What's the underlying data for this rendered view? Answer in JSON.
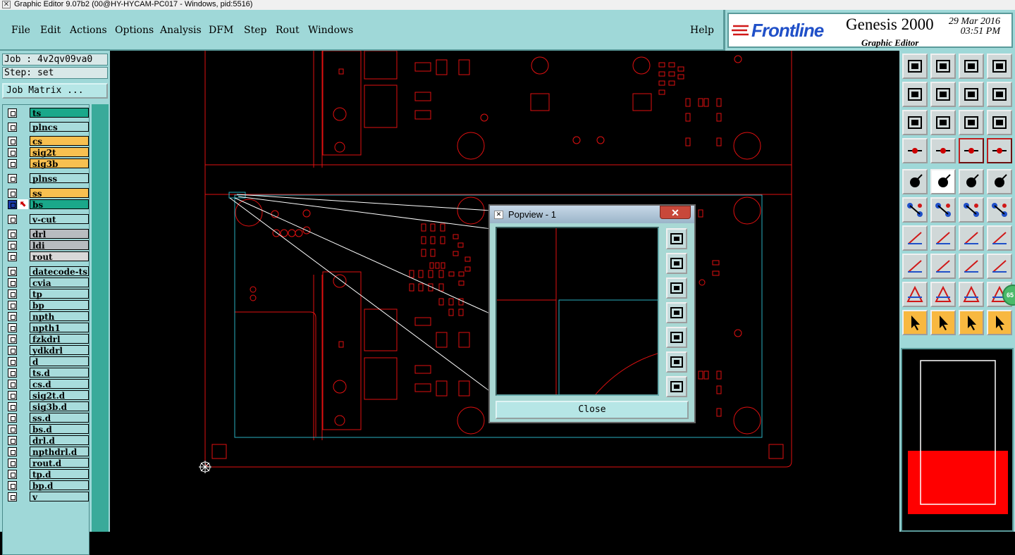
{
  "window": {
    "title": "Graphic Editor 9.07b2 (00@HY-HYCAM-PC017 - Windows, pid:5516)"
  },
  "menu": {
    "items": [
      {
        "label": "File"
      },
      {
        "label": "Edit"
      },
      {
        "label": "Actions"
      },
      {
        "label": "Options"
      },
      {
        "label": "Analysis"
      },
      {
        "label": "DFM"
      },
      {
        "label": "Step"
      },
      {
        "label": "Rout"
      },
      {
        "label": "Windows"
      }
    ],
    "help": "Help"
  },
  "brand": {
    "logo": "Frontline",
    "product": "Genesis 2000",
    "date": "29 Mar 2016",
    "time": "03:51 PM",
    "subtitle": "Graphic Editor"
  },
  "job": {
    "job_label": "Job : 4v2qv09va0",
    "step_label": "Step: set",
    "matrix_button": "Job Matrix ..."
  },
  "layers": [
    {
      "name": "ts",
      "color": "#1aa88a"
    },
    {
      "name": "plncs",
      "color": "#a8dcdc"
    },
    {
      "name": "cs",
      "color": "#f8c050"
    },
    {
      "name": "sig2t",
      "color": "#f8c050"
    },
    {
      "name": "sig3b",
      "color": "#f8c050"
    },
    {
      "name": "plnss",
      "color": "#a8dcdc"
    },
    {
      "name": "ss",
      "color": "#f8c050"
    },
    {
      "name": "bs",
      "color": "#1aa88a",
      "active": true
    },
    {
      "name": "v-cut",
      "color": "#a8dcdc"
    },
    {
      "name": "drl",
      "color": "#b8bcc0"
    },
    {
      "name": "ldi",
      "color": "#b8bcc0"
    },
    {
      "name": "rout",
      "color": "#d8d8d8"
    },
    {
      "name": "datecode-ts",
      "color": "#a8dcdc"
    },
    {
      "name": "cvia",
      "color": "#a8dcdc"
    },
    {
      "name": "tp",
      "color": "#a8dcdc"
    },
    {
      "name": "bp",
      "color": "#a8dcdc"
    },
    {
      "name": "npth",
      "color": "#a8dcdc"
    },
    {
      "name": "npth1",
      "color": "#a8dcdc"
    },
    {
      "name": "fzkdrl",
      "color": "#a8dcdc"
    },
    {
      "name": "ydkdrl",
      "color": "#a8dcdc"
    },
    {
      "name": "d",
      "color": "#a8dcdc"
    },
    {
      "name": "ts.d",
      "color": "#a8dcdc"
    },
    {
      "name": "cs.d",
      "color": "#a8dcdc"
    },
    {
      "name": "sig2t.d",
      "color": "#a8dcdc"
    },
    {
      "name": "sig3b.d",
      "color": "#a8dcdc"
    },
    {
      "name": "ss.d",
      "color": "#a8dcdc"
    },
    {
      "name": "bs.d",
      "color": "#a8dcdc"
    },
    {
      "name": "drl.d",
      "color": "#a8dcdc"
    },
    {
      "name": "npthdrl.d",
      "color": "#a8dcdc"
    },
    {
      "name": "rout.d",
      "color": "#a8dcdc"
    },
    {
      "name": "tp.d",
      "color": "#a8dcdc"
    },
    {
      "name": "bp.d",
      "color": "#a8dcdc"
    },
    {
      "name": "v",
      "color": "#a8dcdc"
    }
  ],
  "popview": {
    "title": "Popview - 1",
    "close_label": "Close"
  },
  "badge": {
    "text": "65"
  },
  "colors": {
    "panel": "#9fd8d8",
    "feature": "#e01010",
    "profile": "#2ab0c0",
    "overview_fill": "#ff0000"
  }
}
